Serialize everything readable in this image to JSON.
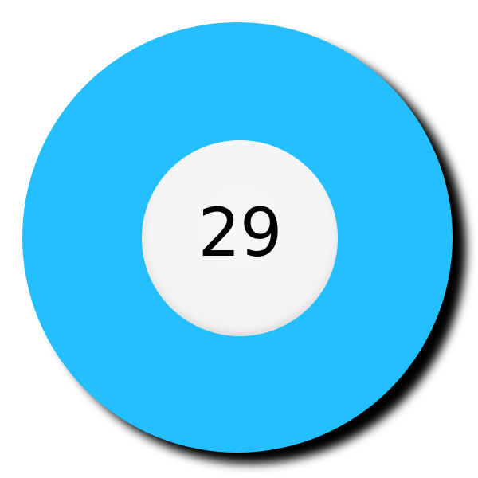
{
  "ball": {
    "number": "29",
    "color": "#23bffe",
    "center_color": "#f3f3f3",
    "number_color": "#000000"
  }
}
